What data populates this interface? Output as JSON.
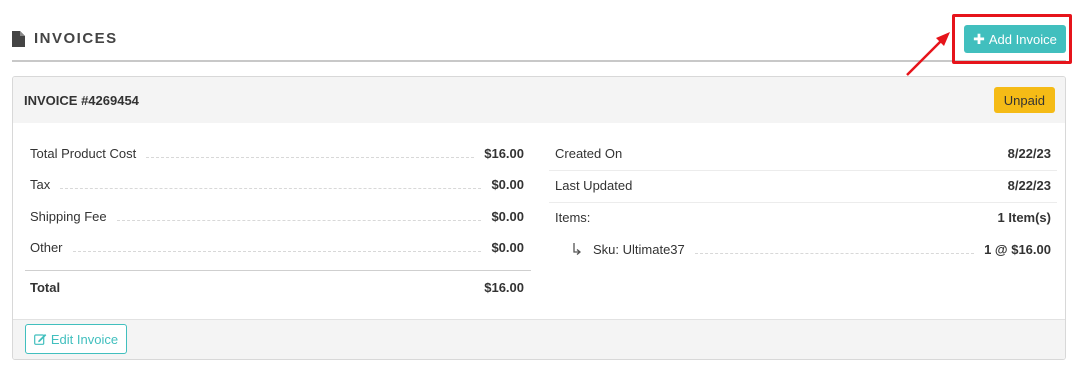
{
  "section": {
    "title": "INVOICES",
    "icon": "document-icon"
  },
  "toolbar": {
    "add_label": "Add Invoice",
    "add_icon": "plus-icon"
  },
  "invoice": {
    "title": "INVOICE #4269454",
    "status": "Unpaid",
    "costs": [
      {
        "label": "Total Product Cost",
        "value": "$16.00"
      },
      {
        "label": "Tax",
        "value": "$0.00"
      },
      {
        "label": "Shipping Fee",
        "value": "$0.00"
      },
      {
        "label": "Other",
        "value": "$0.00"
      }
    ],
    "total": {
      "label": "Total",
      "value": "$16.00"
    },
    "meta": [
      {
        "label": "Created On",
        "value": "8/22/23"
      },
      {
        "label": "Last Updated",
        "value": "8/22/23"
      },
      {
        "label": "Items:",
        "value": "1 Item(s)"
      }
    ],
    "items": [
      {
        "label": "Sku: Ultimate37",
        "value": "1 @ $16.00"
      }
    ],
    "edit_label": "Edit Invoice",
    "edit_icon": "edit-icon"
  },
  "colors": {
    "accent": "#41bfbe",
    "badge": "#f5bb16",
    "highlight": "#e6141b"
  }
}
